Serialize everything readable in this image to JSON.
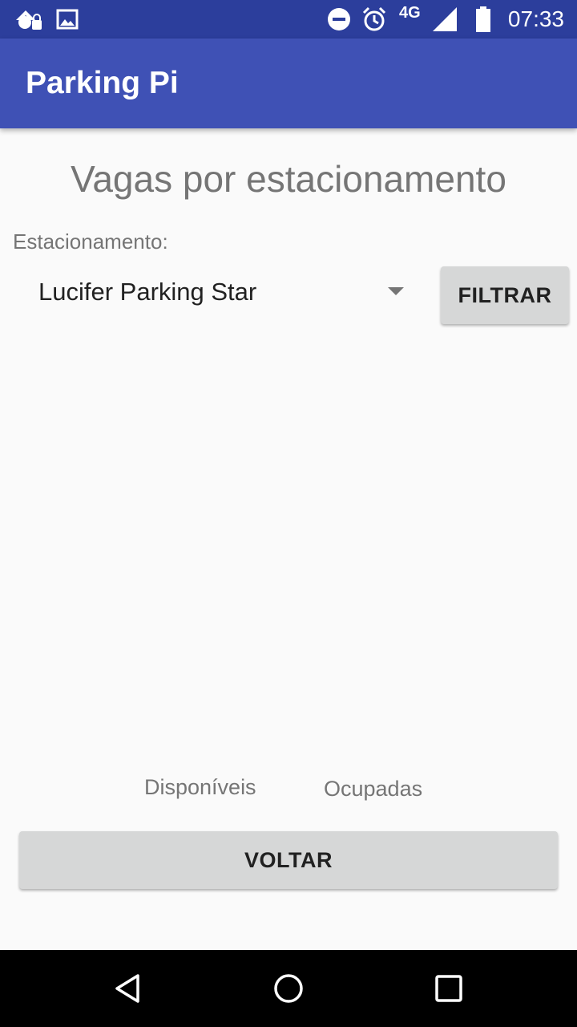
{
  "status_bar": {
    "icons": [
      "notification-icon",
      "image-icon",
      "do-not-disturb-icon",
      "alarm-icon",
      "cell-signal-icon",
      "battery-icon"
    ],
    "network": "4G",
    "time": "07:33"
  },
  "app_bar": {
    "title": "Parking Pi",
    "color": "#3f51b5"
  },
  "main": {
    "heading": "Vagas por estacionamento",
    "parking_label": "Estacionamento:",
    "parking_selected": "Lucifer Parking Star",
    "filter_label": "FILTRAR",
    "legend": {
      "available": "Disponíveis",
      "occupied": "Ocupadas"
    },
    "back_label": "VOLTAR"
  },
  "nav_bar": {
    "icons": [
      "back-icon",
      "home-icon",
      "recents-icon"
    ]
  }
}
